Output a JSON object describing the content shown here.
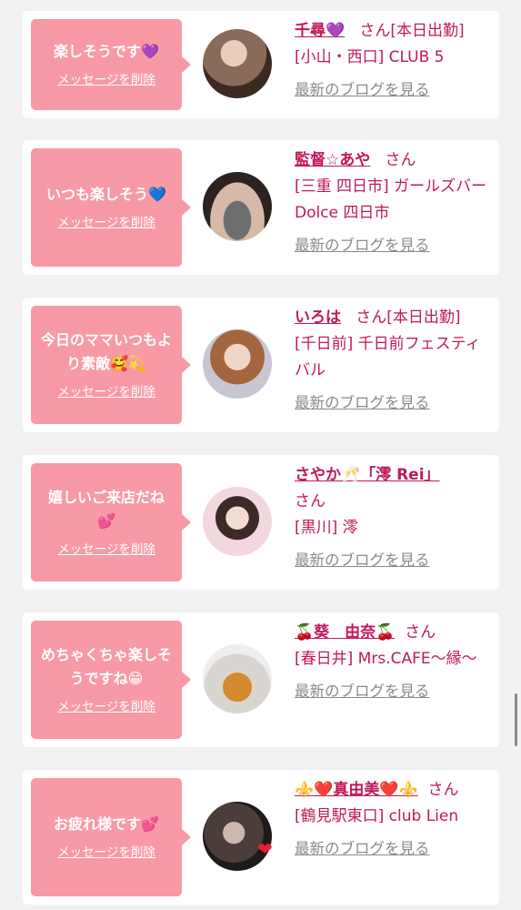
{
  "entries": [
    {
      "message": "楽しそうです💜",
      "delete_label": "メッセージを削除",
      "name": "千尋💜",
      "san": "さん",
      "status": "[本日出勤]",
      "shop": "[小山・西口] CLUB 5",
      "blog_label": "最新のブログを見る"
    },
    {
      "message": "いつも楽しそう💙",
      "delete_label": "メッセージを削除",
      "name": "監督☆あや",
      "san": "さん",
      "status": "",
      "shop": "[三重 四日市] ガールズバー Dolce 四日市",
      "blog_label": "最新のブログを見る"
    },
    {
      "message": "今日のママいつもより素敵🥰💫",
      "delete_label": "メッセージを削除",
      "name": "いろは",
      "san": "さん",
      "status": "[本日出勤]",
      "shop": "[千日前] 千日前フェスティバル",
      "blog_label": "最新のブログを見る"
    },
    {
      "message": "嬉しいご来店だね💕",
      "delete_label": "メッセージを削除",
      "name": "さやか🥂「澪 Rei」",
      "san": "さん",
      "status": "",
      "shop": "[黒川] 澪",
      "blog_label": "最新のブログを見る"
    },
    {
      "message": "めちゃくちゃ楽しそうですね😁",
      "delete_label": "メッセージを削除",
      "name": "🍒葵　由奈🍒",
      "san": "さん",
      "status": "",
      "shop": "[春日井] Mrs.CAFE〜縁〜",
      "blog_label": "最新のブログを見る"
    },
    {
      "message": "お疲れ様です💕",
      "delete_label": "メッセージを削除",
      "name": "⚜️❤️真由美❤️⚜️",
      "san": "さん",
      "status": "",
      "shop": "[鶴見駅東口] club Lien",
      "blog_label": "最新のブログを見る"
    }
  ],
  "colors": {
    "background": "#f2f2f4",
    "bubble": "#f899a6",
    "accent": "#c2185b",
    "link_gray": "#8a8a8a"
  }
}
